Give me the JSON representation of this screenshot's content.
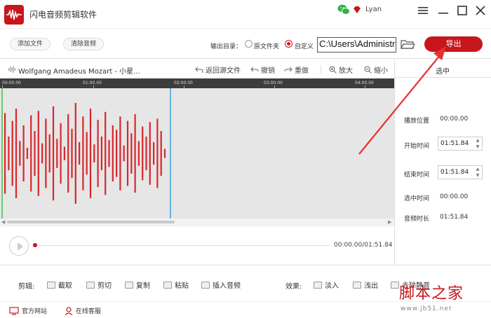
{
  "app": {
    "title": "闪电音频剪辑软件",
    "user": "Lyan"
  },
  "toolbar": {
    "add_file": "添加文件",
    "clear_audio": "清除音频",
    "output_dir_label": "输出目录：",
    "option_source_folder": "原文件夹",
    "option_custom": "自定义",
    "output_path": "C:\\Users\\Administrator",
    "export": "导出"
  },
  "track": {
    "name": "Wolfgang Amadeus Mozart - 小星...",
    "back_to_source": "返回源文件",
    "undo": "撤销",
    "redo": "重做",
    "zoom_in": "放大",
    "zoom_out": "缩小"
  },
  "ruler": {
    "labels": [
      "00:00.00",
      "01:00.00",
      "02:00.00",
      "03:00.00",
      "04:00.00"
    ]
  },
  "player": {
    "time": "00:00.00/01:51.84"
  },
  "side": {
    "header": "选中",
    "play_position_label": "播放位置",
    "play_position_value": "00:00.00",
    "start_label": "开始时间",
    "start_value": "01:51.84",
    "end_label": "结束时间",
    "end_value": "01:51.84",
    "selected_label": "选中时间",
    "selected_value": "00:00.00",
    "duration_label": "音频时长",
    "duration_value": "01:51.84"
  },
  "actions": {
    "edit_label": "剪辑:",
    "trim": "截取",
    "cut": "剪切",
    "copy": "复制",
    "paste": "粘贴",
    "insert_audio": "插入音频",
    "effects_label": "效果:",
    "fade_in": "淡入",
    "fade_out": "浅出",
    "remove_silence": "去除静音"
  },
  "status": {
    "website": "官方网站",
    "support": "在线客服"
  },
  "watermark": {
    "main": "脚本之家",
    "sub": "www.jb51.net"
  },
  "colors": {
    "accent": "#c8161d",
    "ruler": "#3d3d3d",
    "wave_bg": "#e6e6e6",
    "wave": "#d9262c",
    "playhead": "#3aa0e0",
    "start_marker": "#3cc24a"
  }
}
